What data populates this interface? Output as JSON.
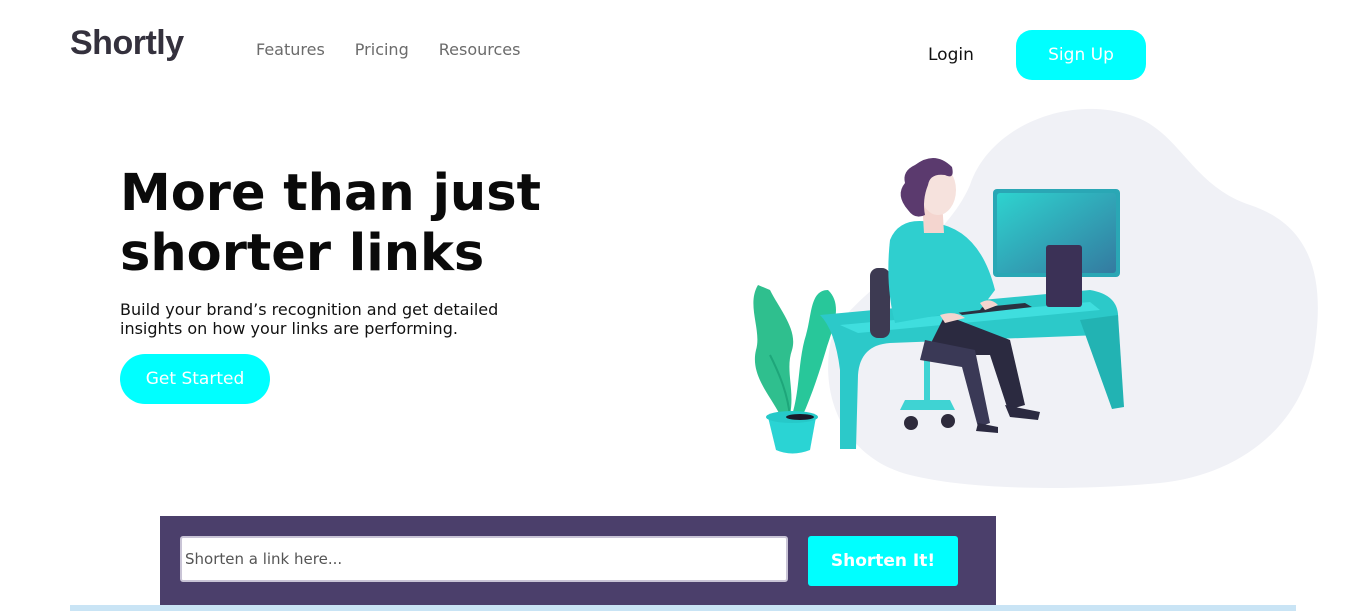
{
  "header": {
    "logo": "Shortly",
    "nav": [
      "Features",
      "Pricing",
      "Resources"
    ],
    "login_label": "Login",
    "signup_label": "Sign Up"
  },
  "hero": {
    "title_line1": "More than just",
    "title_line2": "shorter links",
    "subtitle": "Build your brand’s recognition and get detailed insights on how your links are performing.",
    "cta_label": "Get Started",
    "illustration": "person-working-at-desk-illustration"
  },
  "shorten": {
    "placeholder": "Shorten a link here...",
    "value": "",
    "button_label": "Shorten It!"
  },
  "colors": {
    "accent": "#00ffff",
    "shorten_bg": "#4b3f6b",
    "text_dark": "#34313d",
    "blob": "#f0f1f6"
  }
}
